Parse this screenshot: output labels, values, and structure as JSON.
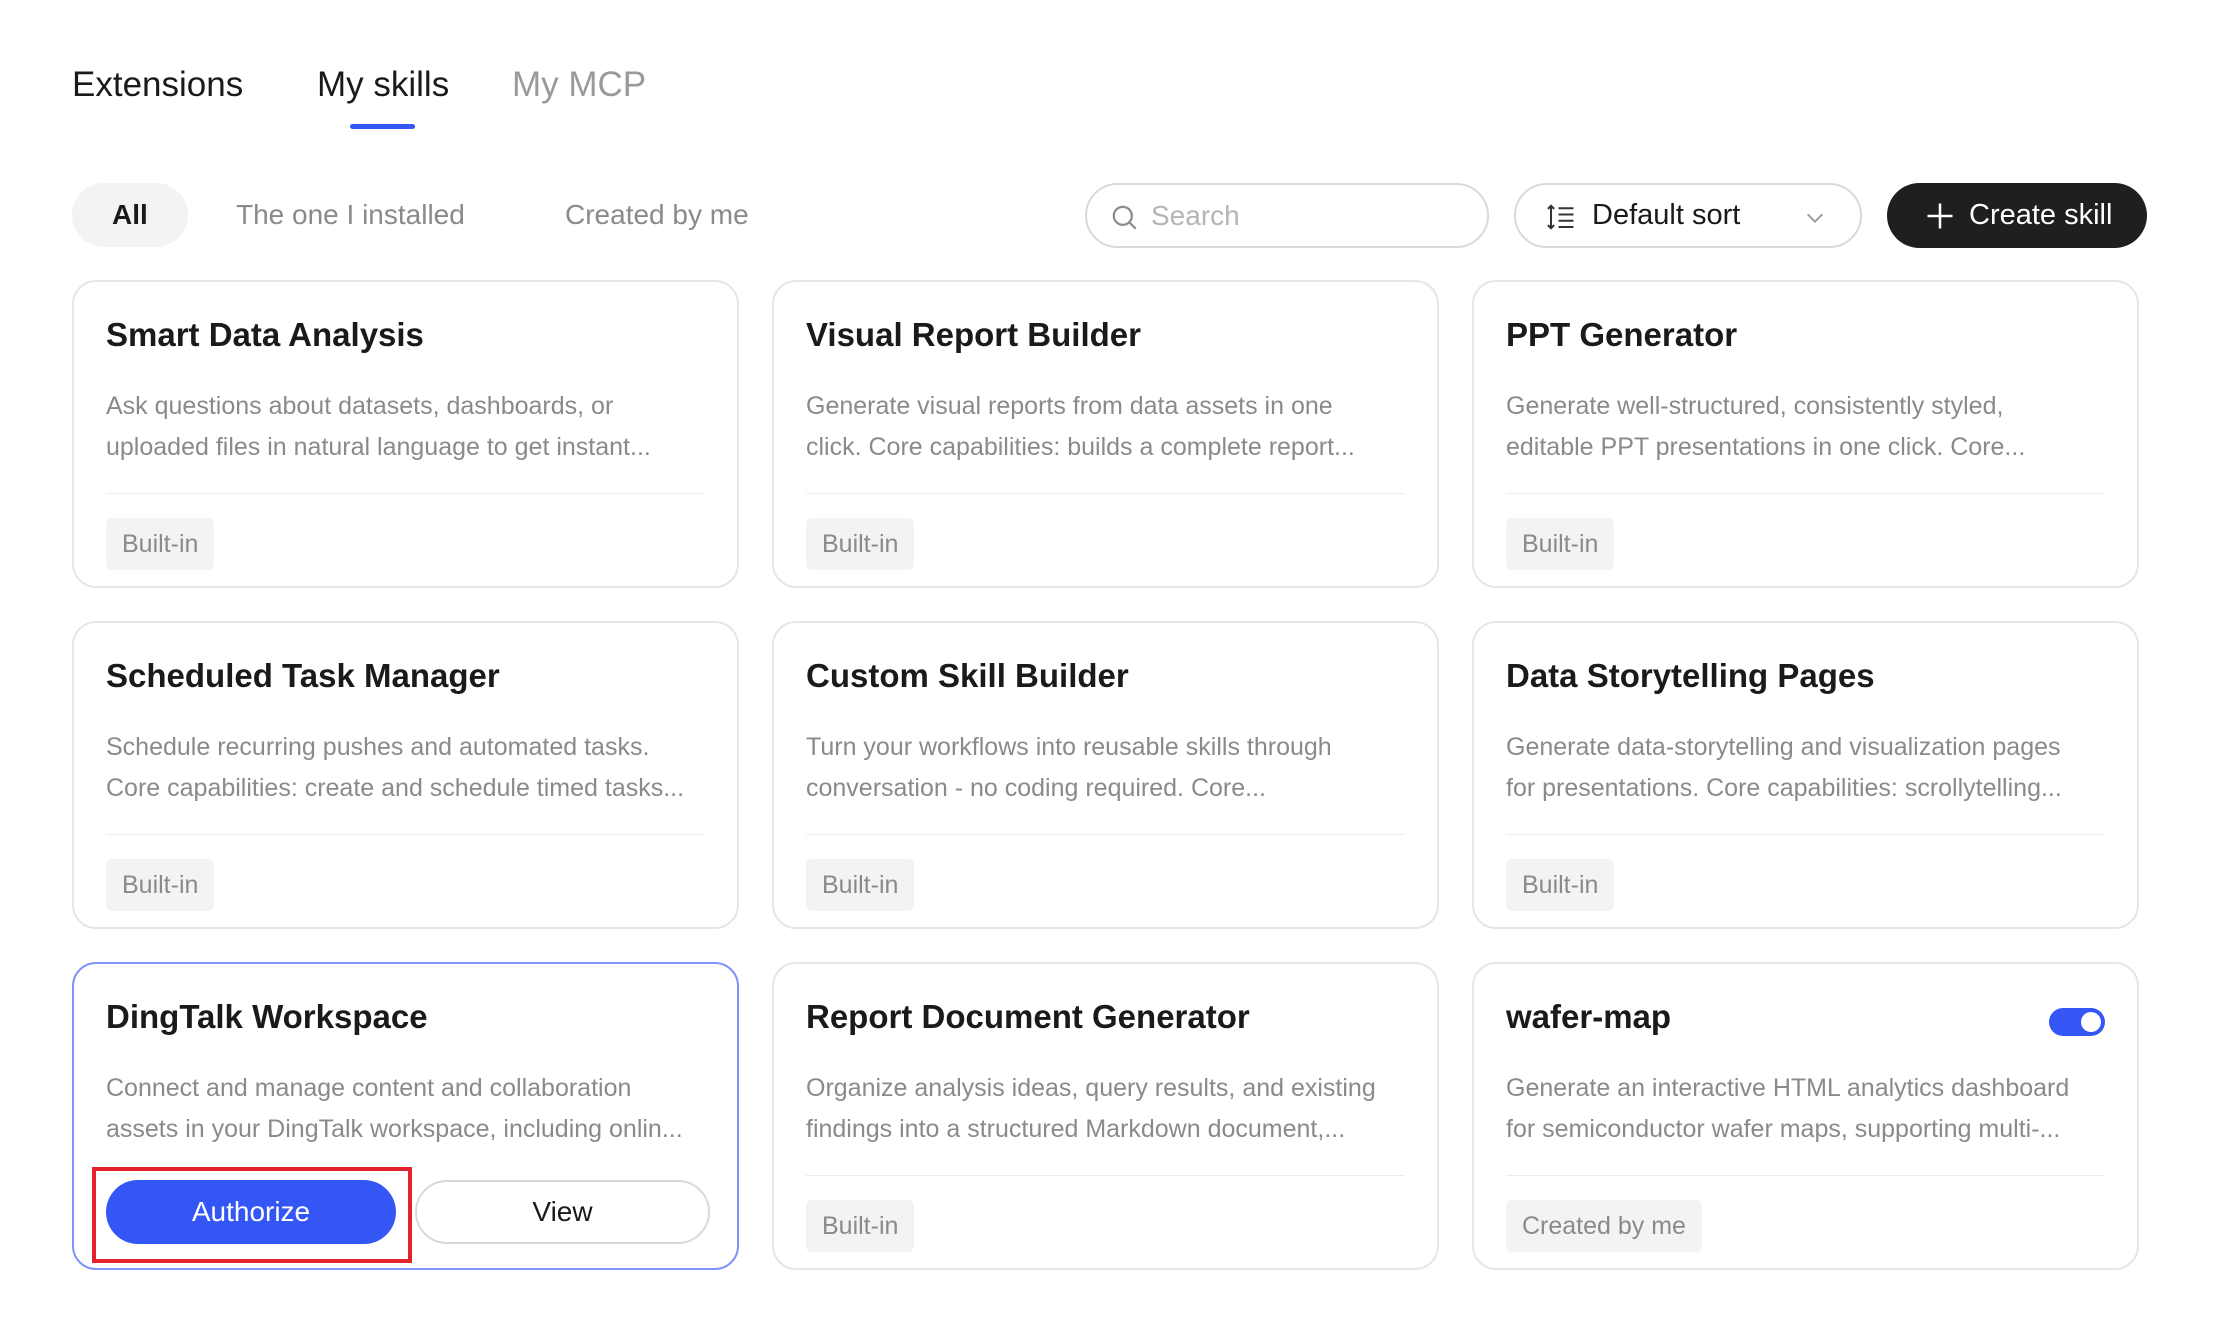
{
  "header": {
    "title": "Extensions",
    "tabs": [
      {
        "label": "My skills",
        "active": true
      },
      {
        "label": "My MCP",
        "active": false
      }
    ]
  },
  "filters": {
    "items": [
      {
        "label": "All",
        "selected": true
      },
      {
        "label": "The one I installed",
        "selected": false
      },
      {
        "label": "Created by me",
        "selected": false
      }
    ]
  },
  "search": {
    "placeholder": "Search",
    "value": ""
  },
  "sort": {
    "label": "Default sort"
  },
  "create_button": {
    "label": "Create skill"
  },
  "colors": {
    "accent": "#3356f5",
    "dark_button": "#1f1f1f",
    "highlight_outline": "#e3232c"
  },
  "cards": [
    {
      "title": "Smart Data Analysis",
      "desc_line1": "Ask questions about datasets, dashboards, or",
      "desc_line2": "uploaded files in natural language to get instant...",
      "tag": "Built-in"
    },
    {
      "title": "Visual Report Builder",
      "desc_line1": "Generate visual reports from data assets in one",
      "desc_line2": "click. Core capabilities: builds a complete report...",
      "tag": "Built-in"
    },
    {
      "title": "PPT Generator",
      "desc_line1": "Generate well-structured, consistently styled,",
      "desc_line2": "editable PPT presentations in one click. Core...",
      "tag": "Built-in"
    },
    {
      "title": "Scheduled Task Manager",
      "desc_line1": "Schedule recurring pushes and automated tasks.",
      "desc_line2": "Core capabilities: create and schedule timed tasks...",
      "tag": "Built-in"
    },
    {
      "title": "Custom Skill Builder",
      "desc_line1": "Turn your workflows into reusable skills through",
      "desc_line2": "conversation - no coding required. Core...",
      "tag": "Built-in"
    },
    {
      "title": "Data Storytelling Pages",
      "desc_line1": "Generate data-storytelling and visualization pages",
      "desc_line2": "for presentations. Core capabilities: scrollytelling...",
      "tag": "Built-in"
    },
    {
      "title": "DingTalk Workspace",
      "desc_line1": "Connect and manage content and collaboration",
      "desc_line2": "assets in your DingTalk workspace, including onlin...",
      "authorize_label": "Authorize",
      "view_label": "View"
    },
    {
      "title": "Report Document Generator",
      "desc_line1": "Organize analysis ideas, query results, and existing",
      "desc_line2": "findings into a structured Markdown document,...",
      "tag": "Built-in"
    },
    {
      "title": "wafer-map",
      "desc_line1": "Generate an interactive HTML analytics dashboard",
      "desc_line2": "for semiconductor wafer maps, supporting multi-...",
      "tag": "Created by me",
      "toggle_on": true
    }
  ]
}
